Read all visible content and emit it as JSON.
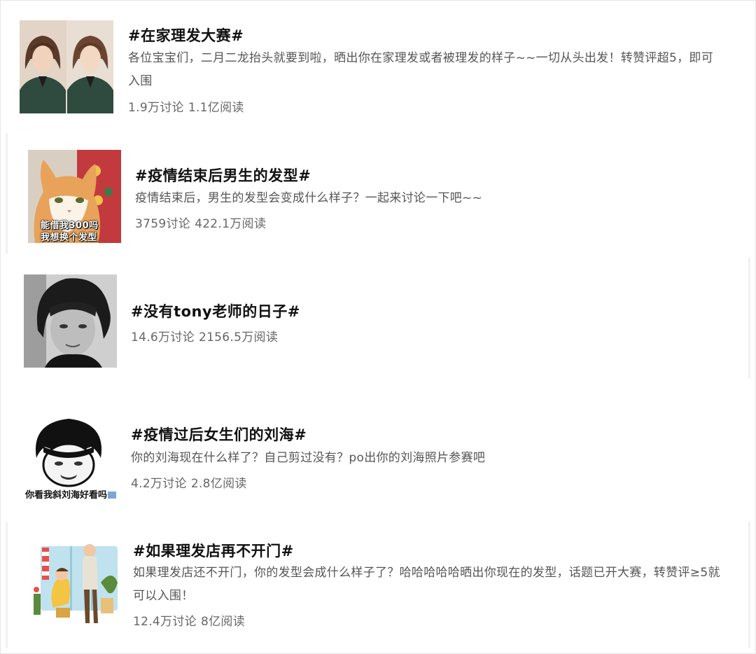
{
  "topics": [
    {
      "title": "#在家理发大赛#",
      "description": "各位宝宝们，二月二龙抬头就要到啦，晒出你在家理发或者被理发的样子~~一切从头出发！转赞评超5，即可入围",
      "discussions": "1.9万讨论",
      "reads": "1.1亿阅读",
      "thumbnail": "two-women-bob-haircut-photo"
    },
    {
      "title": "#疫情结束后男生的发型#",
      "description": "疫情结束后，男生的发型会变成什么样子？一起来讨论一下吧~~",
      "discussions": "3759讨论",
      "reads": "422.1万阅读",
      "thumbnail": "orange-cat-meme",
      "thumbnail_caption_1": "能借我300吗",
      "thumbnail_caption_2": "我想换个发型"
    },
    {
      "title": "#没有tony老师的日子#",
      "description": "",
      "discussions": "14.6万讨论",
      "reads": "2156.5万阅读",
      "thumbnail": "black-and-white-portrait-long-hair-man"
    },
    {
      "title": "#疫情过后女生们的刘海#",
      "description": "你的刘海现在什么样了？自己剪过没有？po出你的刘海照片参赛吧",
      "discussions": "4.2万讨论",
      "reads": "2.8亿阅读",
      "thumbnail": "bangs-meme-face",
      "thumbnail_caption_1": "你看我斜刘海好看吗"
    },
    {
      "title": "#如果理发店再不开门#",
      "description": "如果理发店还不开门，你的发型会成什么样子了？哈哈哈哈哈晒出你现在的发型，话题已开大赛，转赞评≥5就可以入围！",
      "discussions": "12.4万讨论",
      "reads": "8亿阅读",
      "thumbnail": "barbershop-illustration"
    }
  ],
  "colors": {
    "title": "#111111",
    "description": "#555555",
    "stats": "#666666",
    "border": "#e6e6e6"
  }
}
